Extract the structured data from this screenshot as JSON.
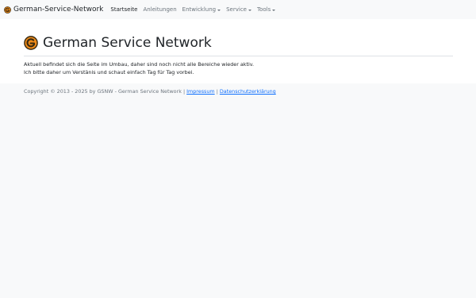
{
  "navbar": {
    "brand_text": "German-Service-Network",
    "items": [
      {
        "label": "Startseite",
        "active": true,
        "dropdown": false
      },
      {
        "label": "Anleitungen",
        "active": false,
        "dropdown": false
      },
      {
        "label": "Entwicklung",
        "active": false,
        "dropdown": true
      },
      {
        "label": "Service",
        "active": false,
        "dropdown": true
      },
      {
        "label": "Tools",
        "active": false,
        "dropdown": true
      }
    ]
  },
  "main": {
    "title": "German Service Network",
    "message_line1": "Aktuell befindet sich die Seite im Umbau, daher sind noch nicht alle Bereiche wieder aktiv.",
    "message_line2": "Ich bitte daher um Verstänis und schaut einfach Tag für Tag vorbei."
  },
  "footer": {
    "copyright": "Copyright © 2013 - 2025 by GSNW - German Service Network | ",
    "impressum": "Impressum",
    "separator": " | ",
    "privacy": "Datenschutzerklärung"
  },
  "colors": {
    "logo_ring": "#f08c1a",
    "logo_mark": "#3a2a10",
    "link": "#0d6efd"
  },
  "icons": {
    "logo": "gsn-logo-icon",
    "dropdown": "caret-down-icon"
  }
}
